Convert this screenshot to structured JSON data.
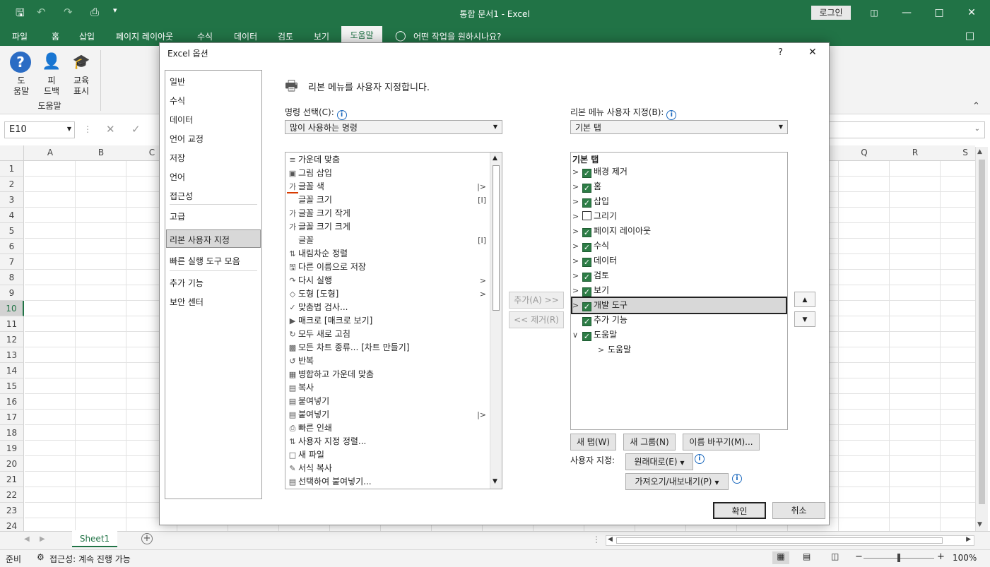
{
  "titlebar": {
    "title": "통합 문서1  -  Excel",
    "login": "로그인",
    "icons": [
      "save-icon",
      "undo-icon",
      "redo-icon",
      "print-preview-icon",
      "customize-qat-icon",
      "ribbon-display-icon",
      "minimize-icon",
      "maximize-icon",
      "close-icon"
    ]
  },
  "tabs": [
    "파일",
    "홈",
    "삽입",
    "페이지 레이아웃",
    "수식",
    "데이터",
    "검토",
    "보기",
    "도움말"
  ],
  "tell_me": "어떤 작업을 원하시나요?",
  "ribbon": {
    "buttons": [
      {
        "line1": "도",
        "line2": "움말"
      },
      {
        "line1": "피",
        "line2": "드백"
      },
      {
        "line1": "교육",
        "line2": "표시"
      }
    ],
    "group": "도움말"
  },
  "formula": {
    "namebox": "E10"
  },
  "grid": {
    "columns": [
      "A",
      "B",
      "C",
      "Q",
      "R",
      "S"
    ],
    "rows": [
      "1",
      "2",
      "3",
      "4",
      "5",
      "6",
      "7",
      "8",
      "9",
      "10",
      "11",
      "12",
      "13",
      "14",
      "15",
      "16",
      "17",
      "18",
      "19",
      "20",
      "21",
      "22",
      "23",
      "24"
    ],
    "selected_row": "10"
  },
  "sheet": {
    "tab": "Sheet1"
  },
  "status": {
    "ready": "준비",
    "accessibility": "접근성: 계속 진행 가능",
    "zoom": "100%"
  },
  "dialog": {
    "title": "Excel 옵션",
    "help": "?",
    "close": "✕",
    "nav": [
      "일반",
      "수식",
      "데이터",
      "언어 교정",
      "저장",
      "언어",
      "접근성",
      "고급",
      "리본 사용자 지정",
      "빠른 실행 도구 모음",
      "추가 기능",
      "보안 센터"
    ],
    "heading": "리본 메뉴를 사용자 지정합니다.",
    "choose_label": "명령 선택(C):",
    "choose_value": "많이 사용하는 명령",
    "customize_label": "리본 메뉴 사용자 지정(B):",
    "customize_value": "기본 탭",
    "commands": [
      "가운데 맞춤",
      "그림 삽입",
      "글꼴 색",
      "글꼴 크기",
      "글꼴 크기 작게",
      "글꼴 크기 크게",
      "글꼴",
      "내림차순 정렬",
      "다른 이름으로 저장",
      "다시 실행",
      "도형 [도형]",
      "맞춤법 검사...",
      "매크로 [매크로 보기]",
      "모두 새로 고침",
      "모든 차트 종류... [차트 만들기]",
      "반복",
      "병합하고 가운데 맞춤",
      "복사",
      "붙여넣기",
      "붙여넣기",
      "빠른 인쇄",
      "사용자 지정 정렬...",
      "새 파일",
      "서식 복사",
      "선택하여 붙여넣기..."
    ],
    "add_btn": "추가(A) >>",
    "remove_btn": "<< 제거(R)",
    "tree_header": "기본 탭",
    "tree": [
      {
        "label": "배경 제거",
        "checked": true
      },
      {
        "label": "홈",
        "checked": true
      },
      {
        "label": "삽입",
        "checked": true
      },
      {
        "label": "그리기",
        "checked": false
      },
      {
        "label": "페이지 레이아웃",
        "checked": true
      },
      {
        "label": "수식",
        "checked": true
      },
      {
        "label": "데이터",
        "checked": true
      },
      {
        "label": "검토",
        "checked": true
      },
      {
        "label": "보기",
        "checked": true
      },
      {
        "label": "개발 도구",
        "checked": true
      },
      {
        "label": "추가 기능",
        "checked": true
      },
      {
        "label": "도움말",
        "checked": true
      }
    ],
    "tree_child": "도움말",
    "new_tab": "새 탭(W)",
    "new_group": "새 그룹(N)",
    "rename": "이름 바꾸기(M)...",
    "customize_label2": "사용자 지정:",
    "reset": "원래대로(E)",
    "import_export": "가져오기/내보내기(P)",
    "ok": "확인",
    "cancel": "취소"
  }
}
